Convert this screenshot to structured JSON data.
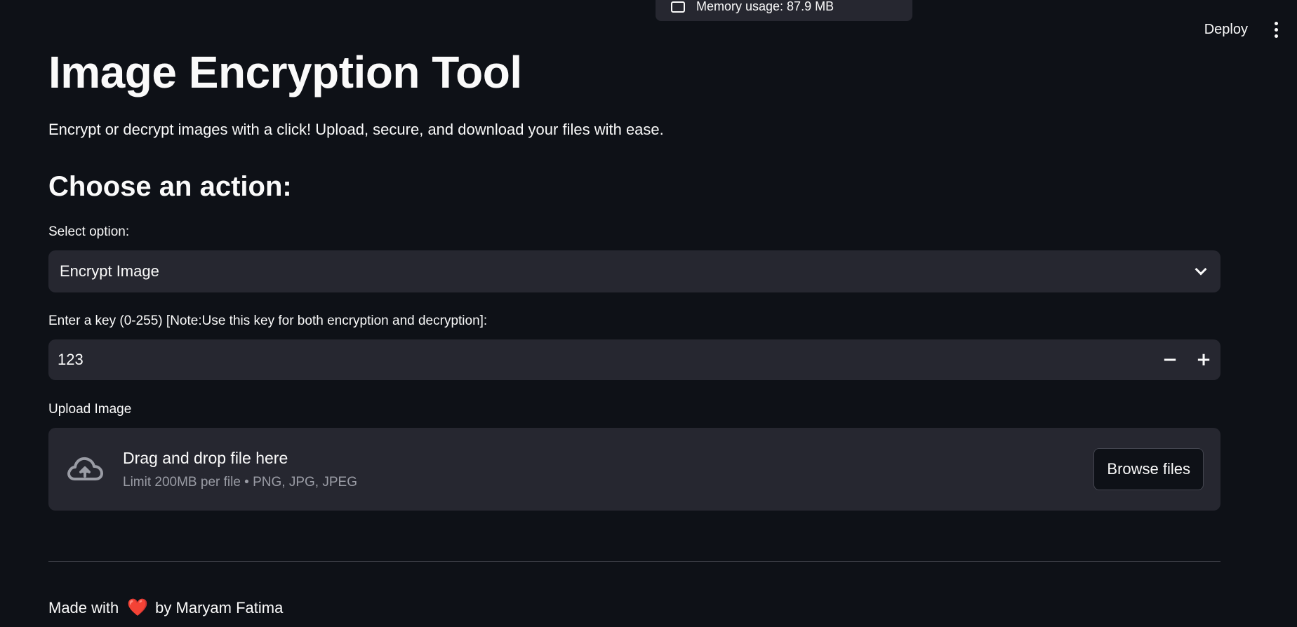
{
  "toast": {
    "text": "Memory usage: 87.9 MB",
    "icon": "memory-icon"
  },
  "toolbar": {
    "deploy_label": "Deploy",
    "menu_icon": "kebab-menu-icon"
  },
  "page": {
    "title": "Image Encryption Tool",
    "subtitle": "Encrypt or decrypt images with a click! Upload, secure, and download your files with ease.",
    "section_heading": "Choose an action:"
  },
  "select": {
    "label": "Select option:",
    "value": "Encrypt Image",
    "icon": "chevron-down-icon"
  },
  "key_input": {
    "label": "Enter a key (0-255) [Note:Use this key for both encryption and decryption]:",
    "value": "123",
    "decrement_label": "−",
    "increment_label": "+"
  },
  "uploader": {
    "label": "Upload Image",
    "drag_text": "Drag and drop file here",
    "limit_text": "Limit 200MB per file • PNG, JPG, JPEG",
    "browse_label": "Browse files",
    "icon": "cloud-upload-icon"
  },
  "footer": {
    "prefix": "Made with",
    "heart": "❤️",
    "suffix": "by Maryam Fatima"
  },
  "colors": {
    "background": "#0e1117",
    "surface": "#262730",
    "text": "#fafafa",
    "muted_text": "#9a9ca5",
    "heart": "#e0242b"
  }
}
